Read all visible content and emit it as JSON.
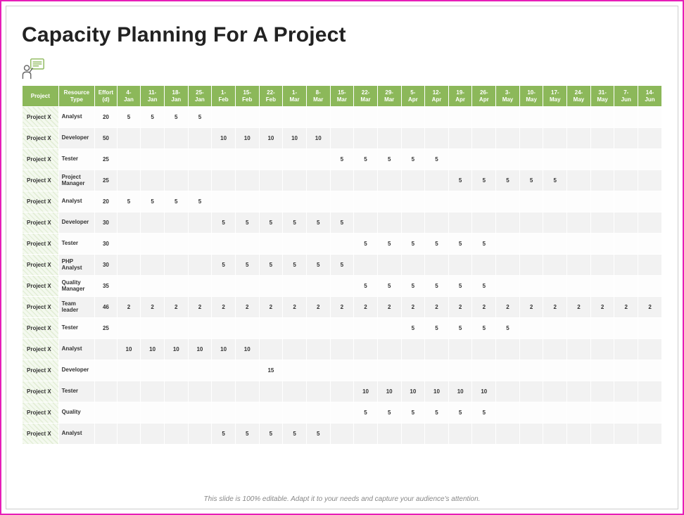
{
  "title": "Capacity Planning For A Project",
  "footnote": "This slide is 100% editable. Adapt it to your needs and capture your audience's attention.",
  "headers": {
    "project": "Project",
    "resource": "Resource Type",
    "effort_line1": "Effort",
    "effort_line2": "(d)"
  },
  "dates": [
    {
      "d": "4-",
      "m": "Jan"
    },
    {
      "d": "11-",
      "m": "Jan"
    },
    {
      "d": "18-",
      "m": "Jan"
    },
    {
      "d": "25-",
      "m": "Jan"
    },
    {
      "d": "1-",
      "m": "Feb"
    },
    {
      "d": "15-",
      "m": "Feb"
    },
    {
      "d": "22-",
      "m": "Feb"
    },
    {
      "d": "1-",
      "m": "Mar"
    },
    {
      "d": "8-",
      "m": "Mar"
    },
    {
      "d": "15-",
      "m": "Mar"
    },
    {
      "d": "22-",
      "m": "Mar"
    },
    {
      "d": "29-",
      "m": "Mar"
    },
    {
      "d": "5-",
      "m": "Apr"
    },
    {
      "d": "12-",
      "m": "Apr"
    },
    {
      "d": "19-",
      "m": "Apr"
    },
    {
      "d": "26-",
      "m": "Apr"
    },
    {
      "d": "3-",
      "m": "May"
    },
    {
      "d": "10-",
      "m": "May"
    },
    {
      "d": "17-",
      "m": "May"
    },
    {
      "d": "24-",
      "m": "May"
    },
    {
      "d": "31-",
      "m": "May"
    },
    {
      "d": "7-",
      "m": "Jun"
    },
    {
      "d": "14-",
      "m": "Jun"
    }
  ],
  "rows": [
    {
      "project": "Project X",
      "resource": "Analyst",
      "effort": "20",
      "cells": [
        "5",
        "5",
        "5",
        "5",
        "",
        "",
        "",
        "",
        "",
        "",
        "",
        "",
        "",
        "",
        "",
        "",
        "",
        "",
        "",
        "",
        "",
        "",
        ""
      ]
    },
    {
      "project": "Project X",
      "resource": "Developer",
      "effort": "50",
      "cells": [
        "",
        "",
        "",
        "",
        "10",
        "10",
        "10",
        "10",
        "10",
        "",
        "",
        "",
        "",
        "",
        "",
        "",
        "",
        "",
        "",
        "",
        "",
        "",
        ""
      ]
    },
    {
      "project": "Project X",
      "resource": "Tester",
      "effort": "25",
      "cells": [
        "",
        "",
        "",
        "",
        "",
        "",
        "",
        "",
        "",
        "5",
        "5",
        "5",
        "5",
        "5",
        "",
        "",
        "",
        "",
        "",
        "",
        "",
        "",
        ""
      ]
    },
    {
      "project": "Project X",
      "resource": "Project Manager",
      "effort": "25",
      "cells": [
        "",
        "",
        "",
        "",
        "",
        "",
        "",
        "",
        "",
        "",
        "",
        "",
        "",
        "",
        "5",
        "5",
        "5",
        "5",
        "5",
        "",
        "",
        "",
        ""
      ]
    },
    {
      "project": "Project X",
      "resource": "Analyst",
      "effort": "20",
      "cells": [
        "5",
        "5",
        "5",
        "5",
        "",
        "",
        "",
        "",
        "",
        "",
        "",
        "",
        "",
        "",
        "",
        "",
        "",
        "",
        "",
        "",
        "",
        "",
        ""
      ]
    },
    {
      "project": "Project X",
      "resource": "Developer",
      "effort": "30",
      "cells": [
        "",
        "",
        "",
        "",
        "5",
        "5",
        "5",
        "5",
        "5",
        "5",
        "",
        "",
        "",
        "",
        "",
        "",
        "",
        "",
        "",
        "",
        "",
        "",
        ""
      ]
    },
    {
      "project": "Project X",
      "resource": "Tester",
      "effort": "30",
      "cells": [
        "",
        "",
        "",
        "",
        "",
        "",
        "",
        "",
        "",
        "",
        "5",
        "5",
        "5",
        "5",
        "5",
        "5",
        "",
        "",
        "",
        "",
        "",
        "",
        ""
      ]
    },
    {
      "project": "Project X",
      "resource": "PHP Analyst",
      "effort": "30",
      "cells": [
        "",
        "",
        "",
        "",
        "5",
        "5",
        "5",
        "5",
        "5",
        "5",
        "",
        "",
        "",
        "",
        "",
        "",
        "",
        "",
        "",
        "",
        "",
        "",
        ""
      ]
    },
    {
      "project": "Project X",
      "resource": "Quality Manager",
      "effort": "35",
      "cells": [
        "",
        "",
        "",
        "",
        "",
        "",
        "",
        "",
        "",
        "",
        "5",
        "5",
        "5",
        "5",
        "5",
        "5",
        "",
        "",
        "",
        "",
        "",
        "",
        ""
      ]
    },
    {
      "project": "Project X",
      "resource": "Team leader",
      "effort": "46",
      "cells": [
        "2",
        "2",
        "2",
        "2",
        "2",
        "2",
        "2",
        "2",
        "2",
        "2",
        "2",
        "2",
        "2",
        "2",
        "2",
        "2",
        "2",
        "2",
        "2",
        "2",
        "2",
        "2",
        "2"
      ]
    },
    {
      "project": "Project X",
      "resource": "Tester",
      "effort": "25",
      "cells": [
        "",
        "",
        "",
        "",
        "",
        "",
        "",
        "",
        "",
        "",
        "",
        "",
        "5",
        "5",
        "5",
        "5",
        "5",
        "",
        "",
        "",
        "",
        "",
        ""
      ]
    },
    {
      "project": "Project X",
      "resource": "Analyst",
      "effort": "",
      "cells": [
        "10",
        "10",
        "10",
        "10",
        "10",
        "10",
        "",
        "",
        "",
        "",
        "",
        "",
        "",
        "",
        "",
        "",
        "",
        "",
        "",
        "",
        "",
        "",
        ""
      ]
    },
    {
      "project": "Project X",
      "resource": "Developer",
      "effort": "",
      "cells": [
        "",
        "",
        "",
        "",
        "",
        "",
        "15",
        "",
        "",
        "",
        "",
        "",
        "",
        "",
        "",
        "",
        "",
        "",
        "",
        "",
        "",
        "",
        ""
      ]
    },
    {
      "project": "Project X",
      "resource": "Tester",
      "effort": "",
      "cells": [
        "",
        "",
        "",
        "",
        "",
        "",
        "",
        "",
        "",
        "",
        "10",
        "10",
        "10",
        "10",
        "10",
        "10",
        "",
        "",
        "",
        "",
        "",
        "",
        ""
      ]
    },
    {
      "project": "Project X",
      "resource": "Quality",
      "effort": "",
      "cells": [
        "",
        "",
        "",
        "",
        "",
        "",
        "",
        "",
        "",
        "",
        "5",
        "5",
        "5",
        "5",
        "5",
        "5",
        "",
        "",
        "",
        "",
        "",
        "",
        ""
      ]
    },
    {
      "project": "Project X",
      "resource": "Analyst",
      "effort": "",
      "cells": [
        "",
        "",
        "",
        "",
        "5",
        "5",
        "5",
        "5",
        "5",
        "",
        "",
        "",
        "",
        "",
        "",
        "",
        "",
        "",
        "",
        "",
        "",
        "",
        ""
      ]
    }
  ]
}
